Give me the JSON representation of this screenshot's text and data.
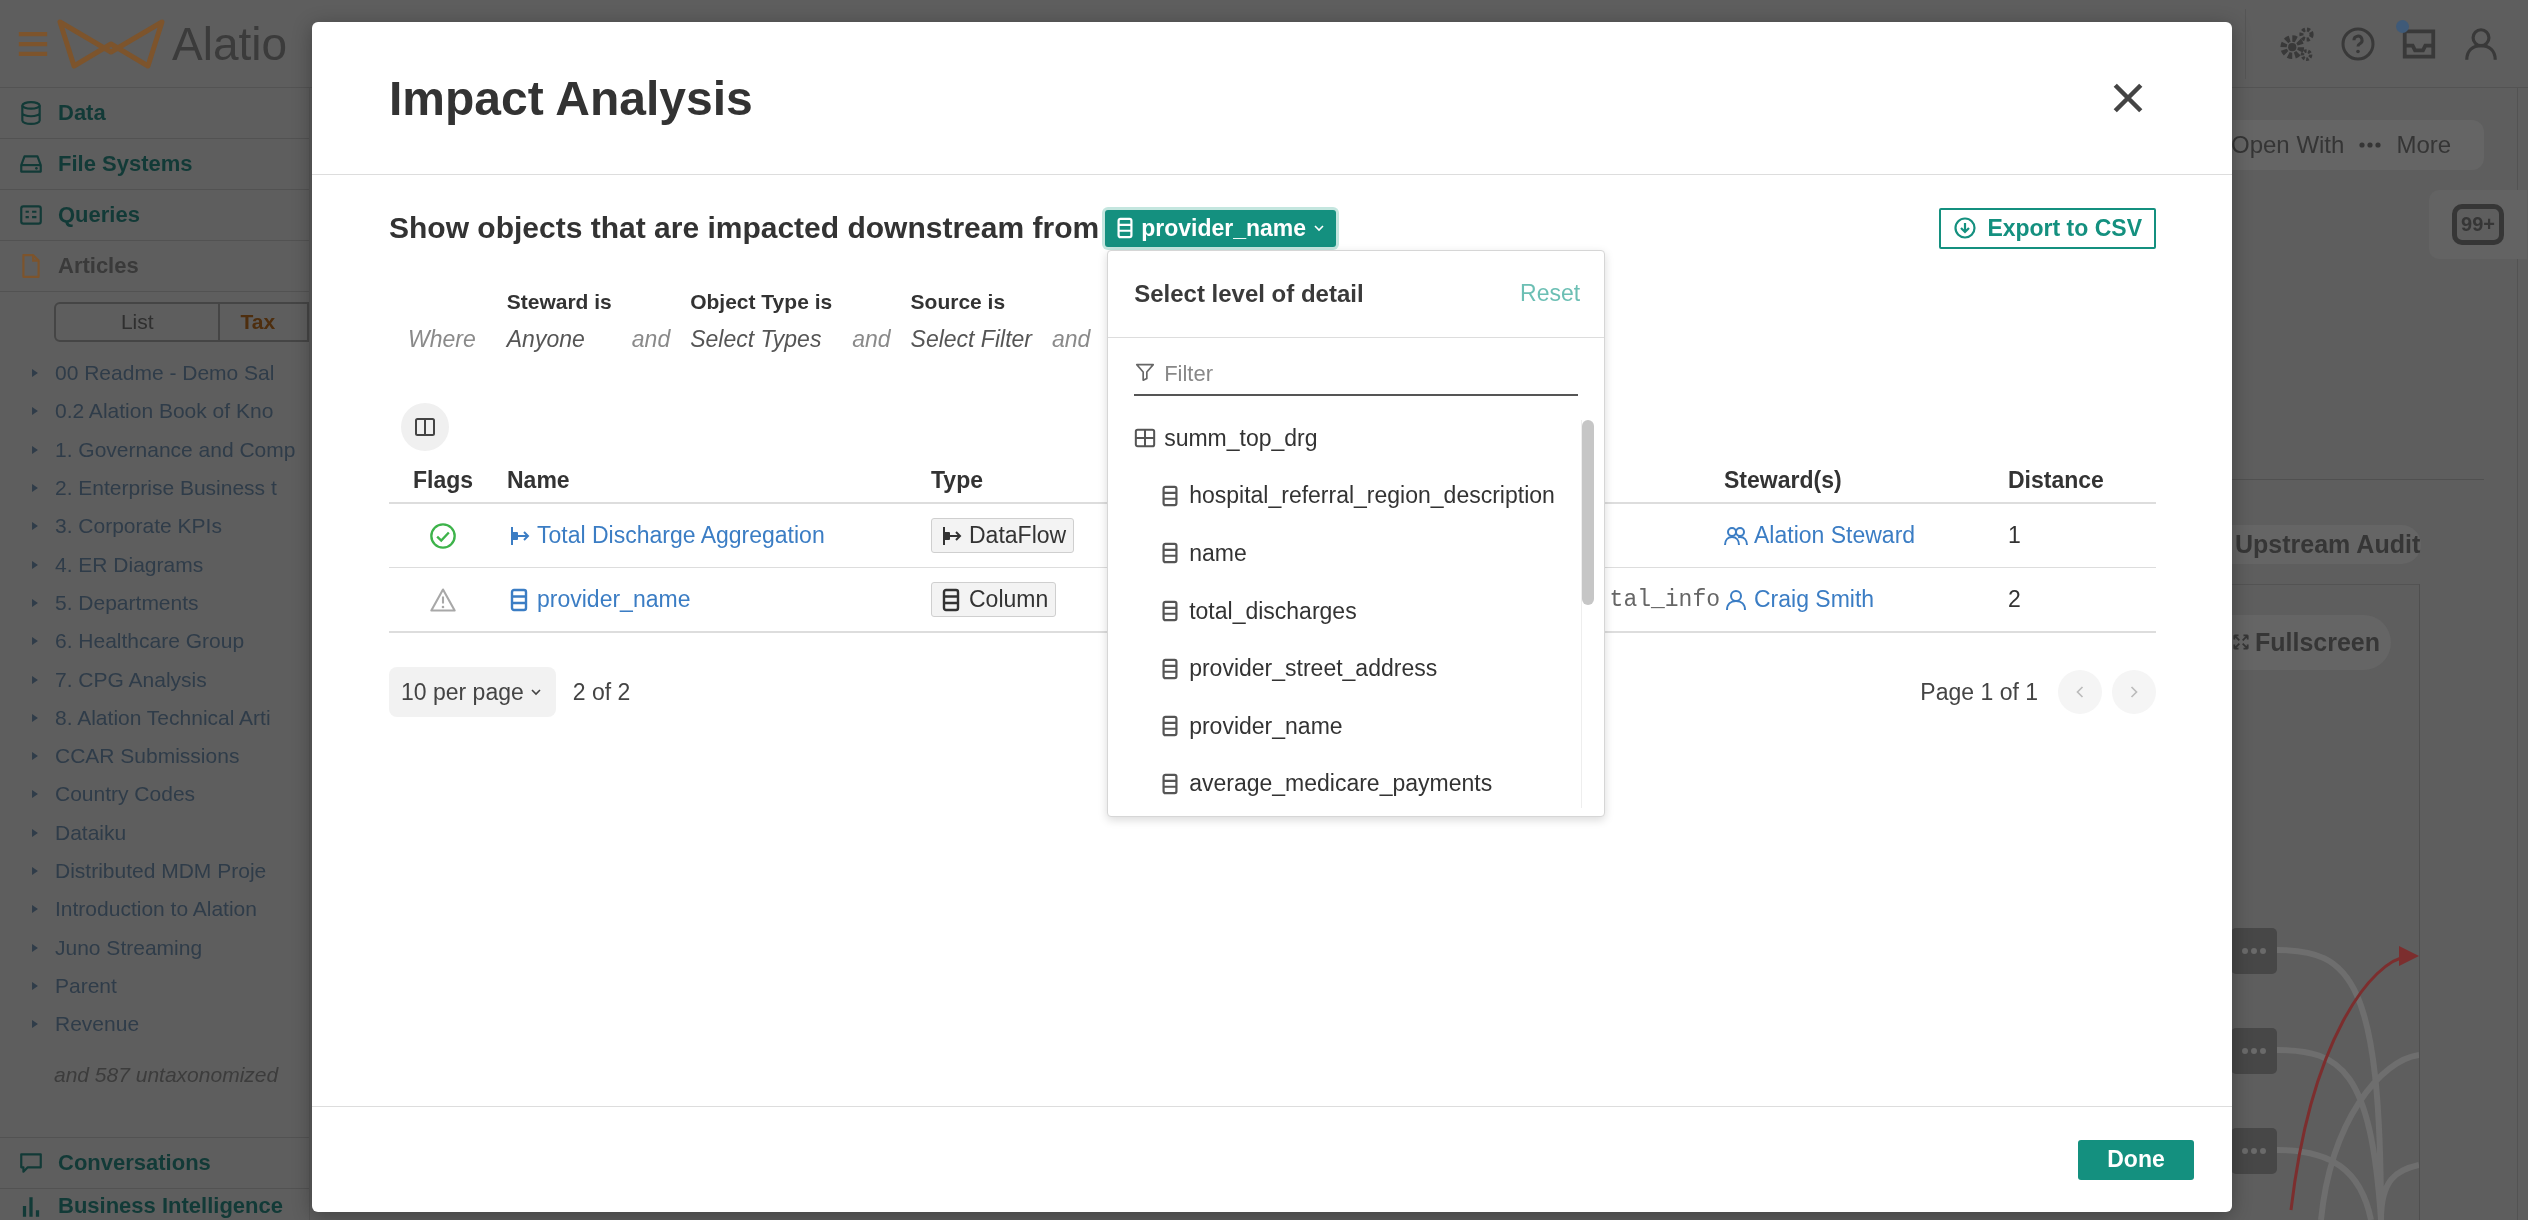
{
  "topbar": {
    "logo_text": "Alatio",
    "inbox_unread": true
  },
  "sidebar": {
    "sections": [
      {
        "label": "Data",
        "kind": "data",
        "selected": false
      },
      {
        "label": "File Systems",
        "kind": "files",
        "selected": false
      },
      {
        "label": "Queries",
        "kind": "queries",
        "selected": false
      },
      {
        "label": "Articles",
        "kind": "articles",
        "selected": true
      }
    ],
    "tabs": [
      {
        "label": "List",
        "selected": false
      },
      {
        "label": "Tax",
        "selected": true
      }
    ],
    "tree": [
      "00 Readme - Demo Sal",
      "0.2 Alation Book of Kno",
      "1. Governance and Comp",
      "2. Enterprise Business t",
      "3. Corporate KPIs",
      "4. ER Diagrams",
      "5. Departments",
      "6. Healthcare Group",
      "7. CPG Analysis",
      "8. Alation Technical Arti",
      "CCAR Submissions",
      "Country Codes",
      "Dataiku",
      "Distributed MDM Proje",
      "Introduction to Alation",
      "Juno Streaming",
      "Parent",
      "Revenue"
    ],
    "tree_note": "and 587 untaxonomized",
    "bottom_sections": [
      {
        "label": "Conversations",
        "kind": "conversations"
      },
      {
        "label": "Business Intelligence",
        "kind": "bi"
      }
    ]
  },
  "right_panel": {
    "actions": [
      {
        "label": "Open With",
        "kind": "open"
      },
      {
        "label": "More",
        "kind": "more"
      }
    ],
    "comment_count": "99+",
    "upstream_audit_button": "Upstream Audit",
    "fullscreen_button": "Fullscreen"
  },
  "modal": {
    "title": "Impact Analysis",
    "heading": "Show objects that are impacted downstream from",
    "source_object": {
      "label": "provider_name",
      "kind": "column"
    },
    "export_button": "Export to CSV",
    "where_label": "Where",
    "filters": [
      {
        "label": "Steward is",
        "value": "Anyone",
        "joiner": "and"
      },
      {
        "label": "Object Type is",
        "value": "Select Types",
        "joiner": "and"
      },
      {
        "label": "Source is",
        "value": "Select Filter",
        "joiner": "and"
      }
    ],
    "table": {
      "columns": {
        "flags": "Flags",
        "name": "Name",
        "type": "Type",
        "stewards": "Steward(s)",
        "distance": "Distance"
      },
      "rows": [
        {
          "flag": {
            "kind": "endorsed"
          },
          "name": {
            "text": "Total Discharge Aggregation",
            "kind": "dataflow"
          },
          "type": "DataFlow",
          "steward": {
            "text": "Alation Steward",
            "kind": "group"
          },
          "distance": "1"
        },
        {
          "flag": {
            "kind": "warning"
          },
          "name": {
            "text": "provider_name",
            "kind": "column"
          },
          "type": "Column",
          "column_4": "tal_info",
          "steward": {
            "text": "Craig Smith",
            "kind": "user"
          },
          "distance": "2"
        }
      ]
    },
    "pagination": {
      "per_page": "10 per page",
      "range": "2 of 2",
      "page": "Page 1 of 1"
    },
    "done_button": "Done",
    "level_menu": {
      "title": "Select level of detail",
      "reset": "Reset",
      "filter_placeholder": "Filter",
      "items": [
        {
          "label": "summ_top_drg",
          "kind": "table",
          "children": [
            {
              "label": "hospital_referral_region_description",
              "kind": "column"
            },
            {
              "label": "name",
              "kind": "column"
            },
            {
              "label": "total_discharges",
              "kind": "column"
            },
            {
              "label": "provider_street_address",
              "kind": "column"
            },
            {
              "label": "provider_name",
              "kind": "column"
            },
            {
              "label": "average_medicare_payments",
              "kind": "column"
            }
          ]
        }
      ]
    }
  }
}
